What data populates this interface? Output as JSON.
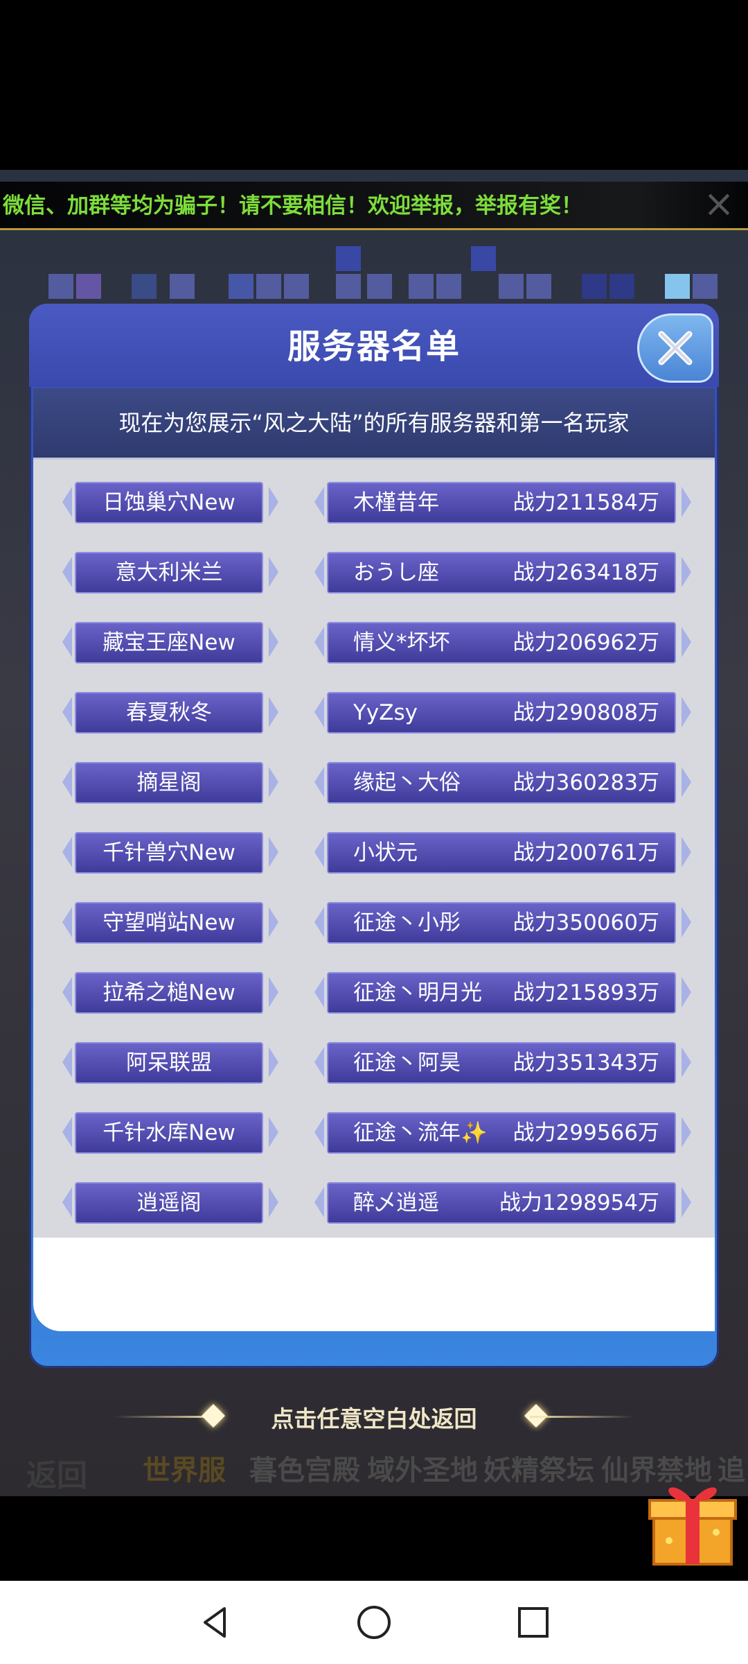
{
  "marquee": {
    "text": "微信、加群等均为骗子！请不要相信！欢迎举报，举报有奖！"
  },
  "dialog": {
    "title": "服务器名单",
    "subheader": "现在为您展示“风之大陆”的所有服务器和第一名玩家",
    "rows": [
      {
        "server": "日蚀巢穴New",
        "player": "木槿昔年",
        "power": "战力211584万"
      },
      {
        "server": "意大利米兰",
        "player": "おうし座",
        "power": "战力263418万"
      },
      {
        "server": "藏宝王座New",
        "player": "情义*坏坏",
        "power": "战力206962万"
      },
      {
        "server": "春夏秋冬",
        "player": "YyZsy",
        "power": "战力290808万"
      },
      {
        "server": "摘星阁",
        "player": "缘起丶大俗",
        "power": "战力360283万"
      },
      {
        "server": "千针兽穴New",
        "player": "小状元",
        "power": "战力200761万"
      },
      {
        "server": "守望哨站New",
        "player": "征途丶小彤",
        "power": "战力350060万"
      },
      {
        "server": "拉希之槌New",
        "player": "征途丶明月光",
        "power": "战力215893万"
      },
      {
        "server": "阿呆联盟",
        "player": "征途丶阿昊",
        "power": "战力351343万"
      },
      {
        "server": "千针水库New",
        "player": "征途丶流年✨",
        "power": "战力299566万"
      },
      {
        "server": "逍遥阁",
        "player": "醉乄逍遥",
        "power": "战力1298954万"
      }
    ]
  },
  "footer": {
    "hint": "点击任意空白处返回"
  },
  "bottom_tabs": {
    "back": "返回",
    "tabs": [
      "世界服",
      "暮色宫殿",
      "域外圣地",
      "妖精祭坛",
      "仙界禁地",
      "追"
    ]
  },
  "icons": {
    "close": "close-icon",
    "gift": "gift-box-icon",
    "nav_back": "back-triangle-icon",
    "nav_home": "home-circle-icon",
    "nav_recent": "recent-square-icon"
  },
  "colors": {
    "marquee_text": "#7dde3a",
    "dialog_blue": "#3c4fb0",
    "button_purple": "#4f4aae"
  }
}
